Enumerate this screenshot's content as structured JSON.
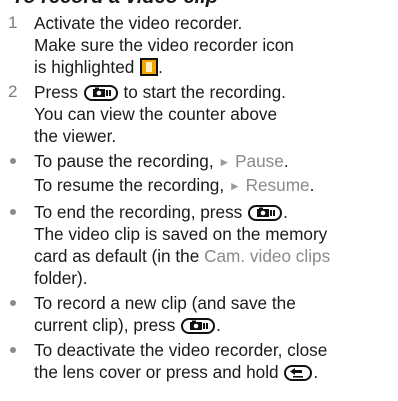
{
  "heading": "To record a video clip",
  "steps": [
    {
      "number": "1",
      "lines": [
        "Activate the video recorder.",
        "Make sure the video recorder icon",
        "is highlighted"
      ],
      "line3_end": "."
    },
    {
      "number": "2",
      "line1_pre": "Press",
      "line1_post": "to start the recording.",
      "line2": "You can view the counter above",
      "line3": "the viewer."
    }
  ],
  "bullets": {
    "pause": {
      "line1_pre": "To pause the recording,",
      "softkey": "Pause",
      "line1_post": ".",
      "line2_pre": "To resume the recording,",
      "softkey2": "Resume",
      "line2_post": "."
    },
    "end": {
      "line1_pre": "To end the recording, press",
      "line1_post": ".",
      "line2": "The video clip is saved on the memory",
      "line3_pre": "card as default (in the",
      "folder": "Cam. video clips",
      "line4": "folder)."
    },
    "new_clip": {
      "line1": "To record a new clip (and save the",
      "line2_pre": "current clip), press",
      "line2_post": "."
    },
    "deactivate": {
      "line1": "To deactivate the video recorder, close",
      "line2_pre": "the lens cover or press and hold",
      "line2_post": "."
    }
  },
  "icons": {
    "camera_key": "camera-key-icon",
    "back_key": "back-key-icon",
    "video_recorder": "video-recorder-icon",
    "softkey_arrow": "softkey-arrow-icon"
  },
  "colors": {
    "text": "#1a1a1a",
    "softkey": "#8a8a8a",
    "icon_highlight": "#f4a300"
  }
}
